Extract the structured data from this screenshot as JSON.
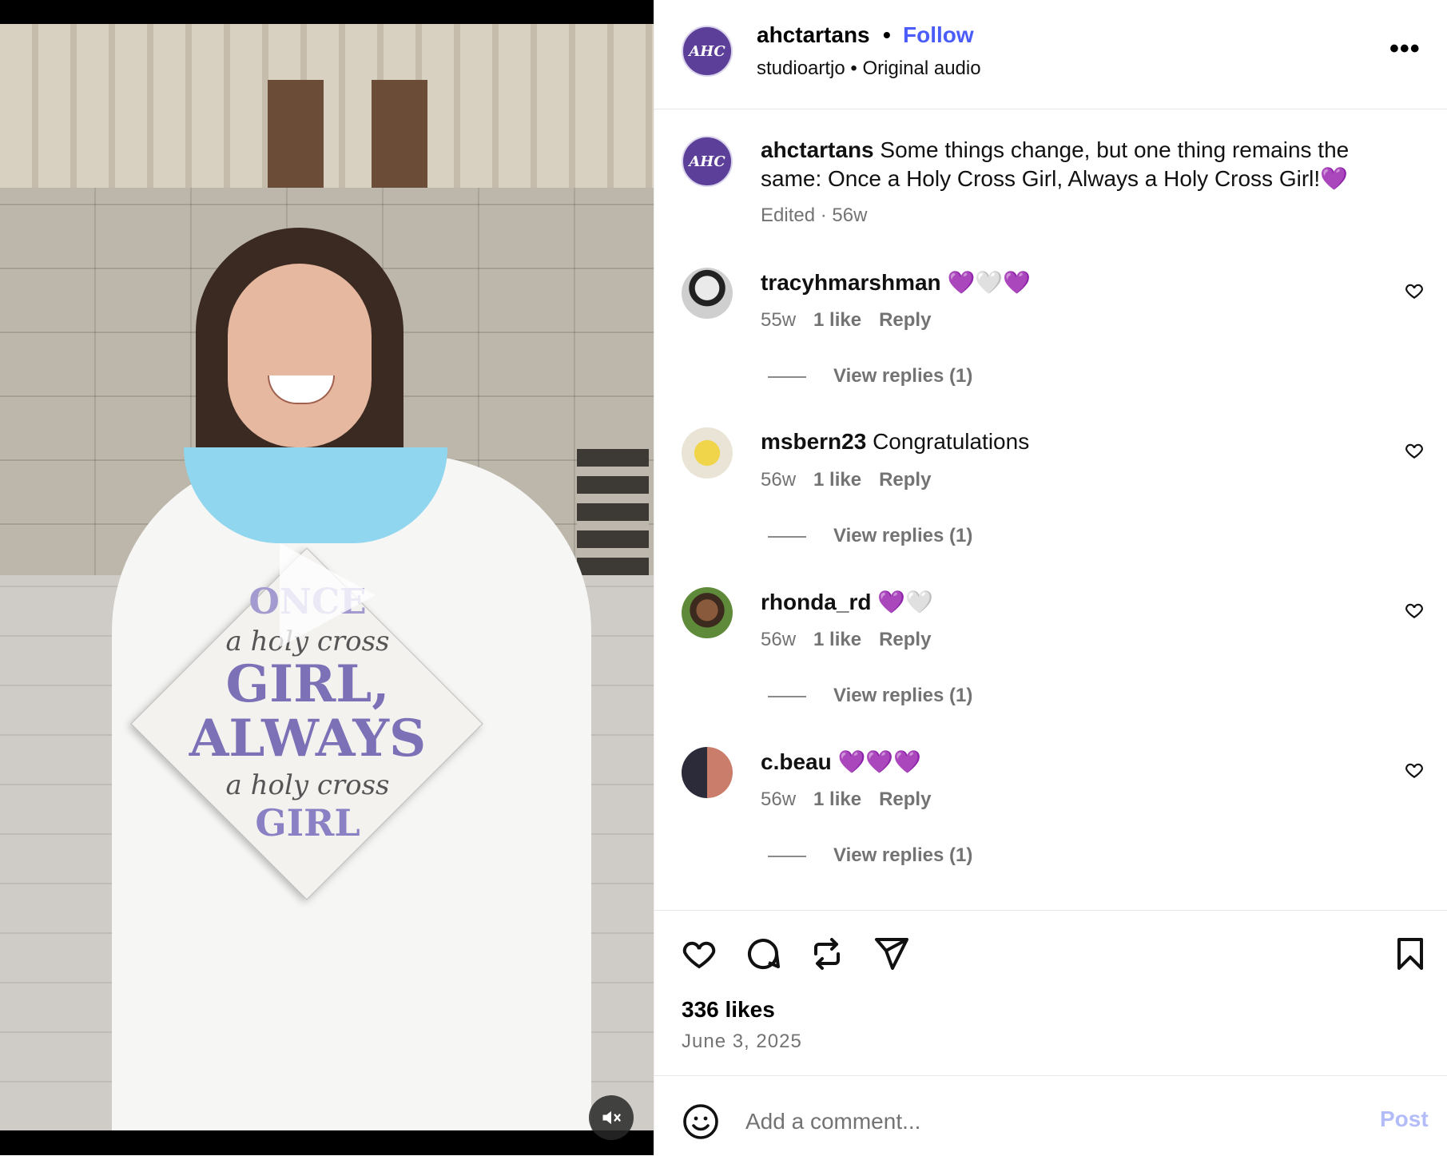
{
  "post": {
    "author": "ahctartans",
    "follow_label": "Follow",
    "separator": "•",
    "audio_user": "studioartjo",
    "audio_label": "Original audio",
    "more_label": "•••",
    "logo_text": "AHC"
  },
  "media": {
    "cap_once": "ONCE",
    "cap_line2": "a holy cross",
    "cap_line3": "GIRL, ALWAYS",
    "cap_line4": "a holy cross",
    "cap_line5": "GIRL",
    "play_icon": "play-icon",
    "mute_icon": "muted-speaker-icon"
  },
  "caption": {
    "user": "ahctartans",
    "text": " Some things change, but one thing remains the same: Once a Holy Cross Girl, Always a Holy Cross Girl!",
    "emoji": "💜",
    "meta": "Edited · 56w"
  },
  "comments": [
    {
      "user": "tracyhmarshman",
      "text": "",
      "emoji": "💜🤍💜",
      "age": "55w",
      "likes": "1 like",
      "reply": "Reply",
      "view_replies": "View replies (1)"
    },
    {
      "user": "msbern23",
      "text": "Congratulations",
      "emoji": "",
      "age": "56w",
      "likes": "1 like",
      "reply": "Reply",
      "view_replies": "View replies (1)"
    },
    {
      "user": "rhonda_rd",
      "text": "",
      "emoji": "💜🤍",
      "age": "56w",
      "likes": "1 like",
      "reply": "Reply",
      "view_replies": "View replies (1)"
    },
    {
      "user": "c.beau",
      "text": "",
      "emoji": "💜💜💜",
      "age": "56w",
      "likes": "1 like",
      "reply": "Reply",
      "view_replies": "View replies (1)"
    }
  ],
  "actions": {
    "likes": "336 likes",
    "date": "June 3, 2025"
  },
  "composer": {
    "placeholder": "Add a comment...",
    "post_label": "Post"
  },
  "colors": {
    "follow": "#4a5df9",
    "muted_text": "#737373",
    "post_disabled": "#b3bcf8",
    "brand_purple": "#5b3f99"
  }
}
